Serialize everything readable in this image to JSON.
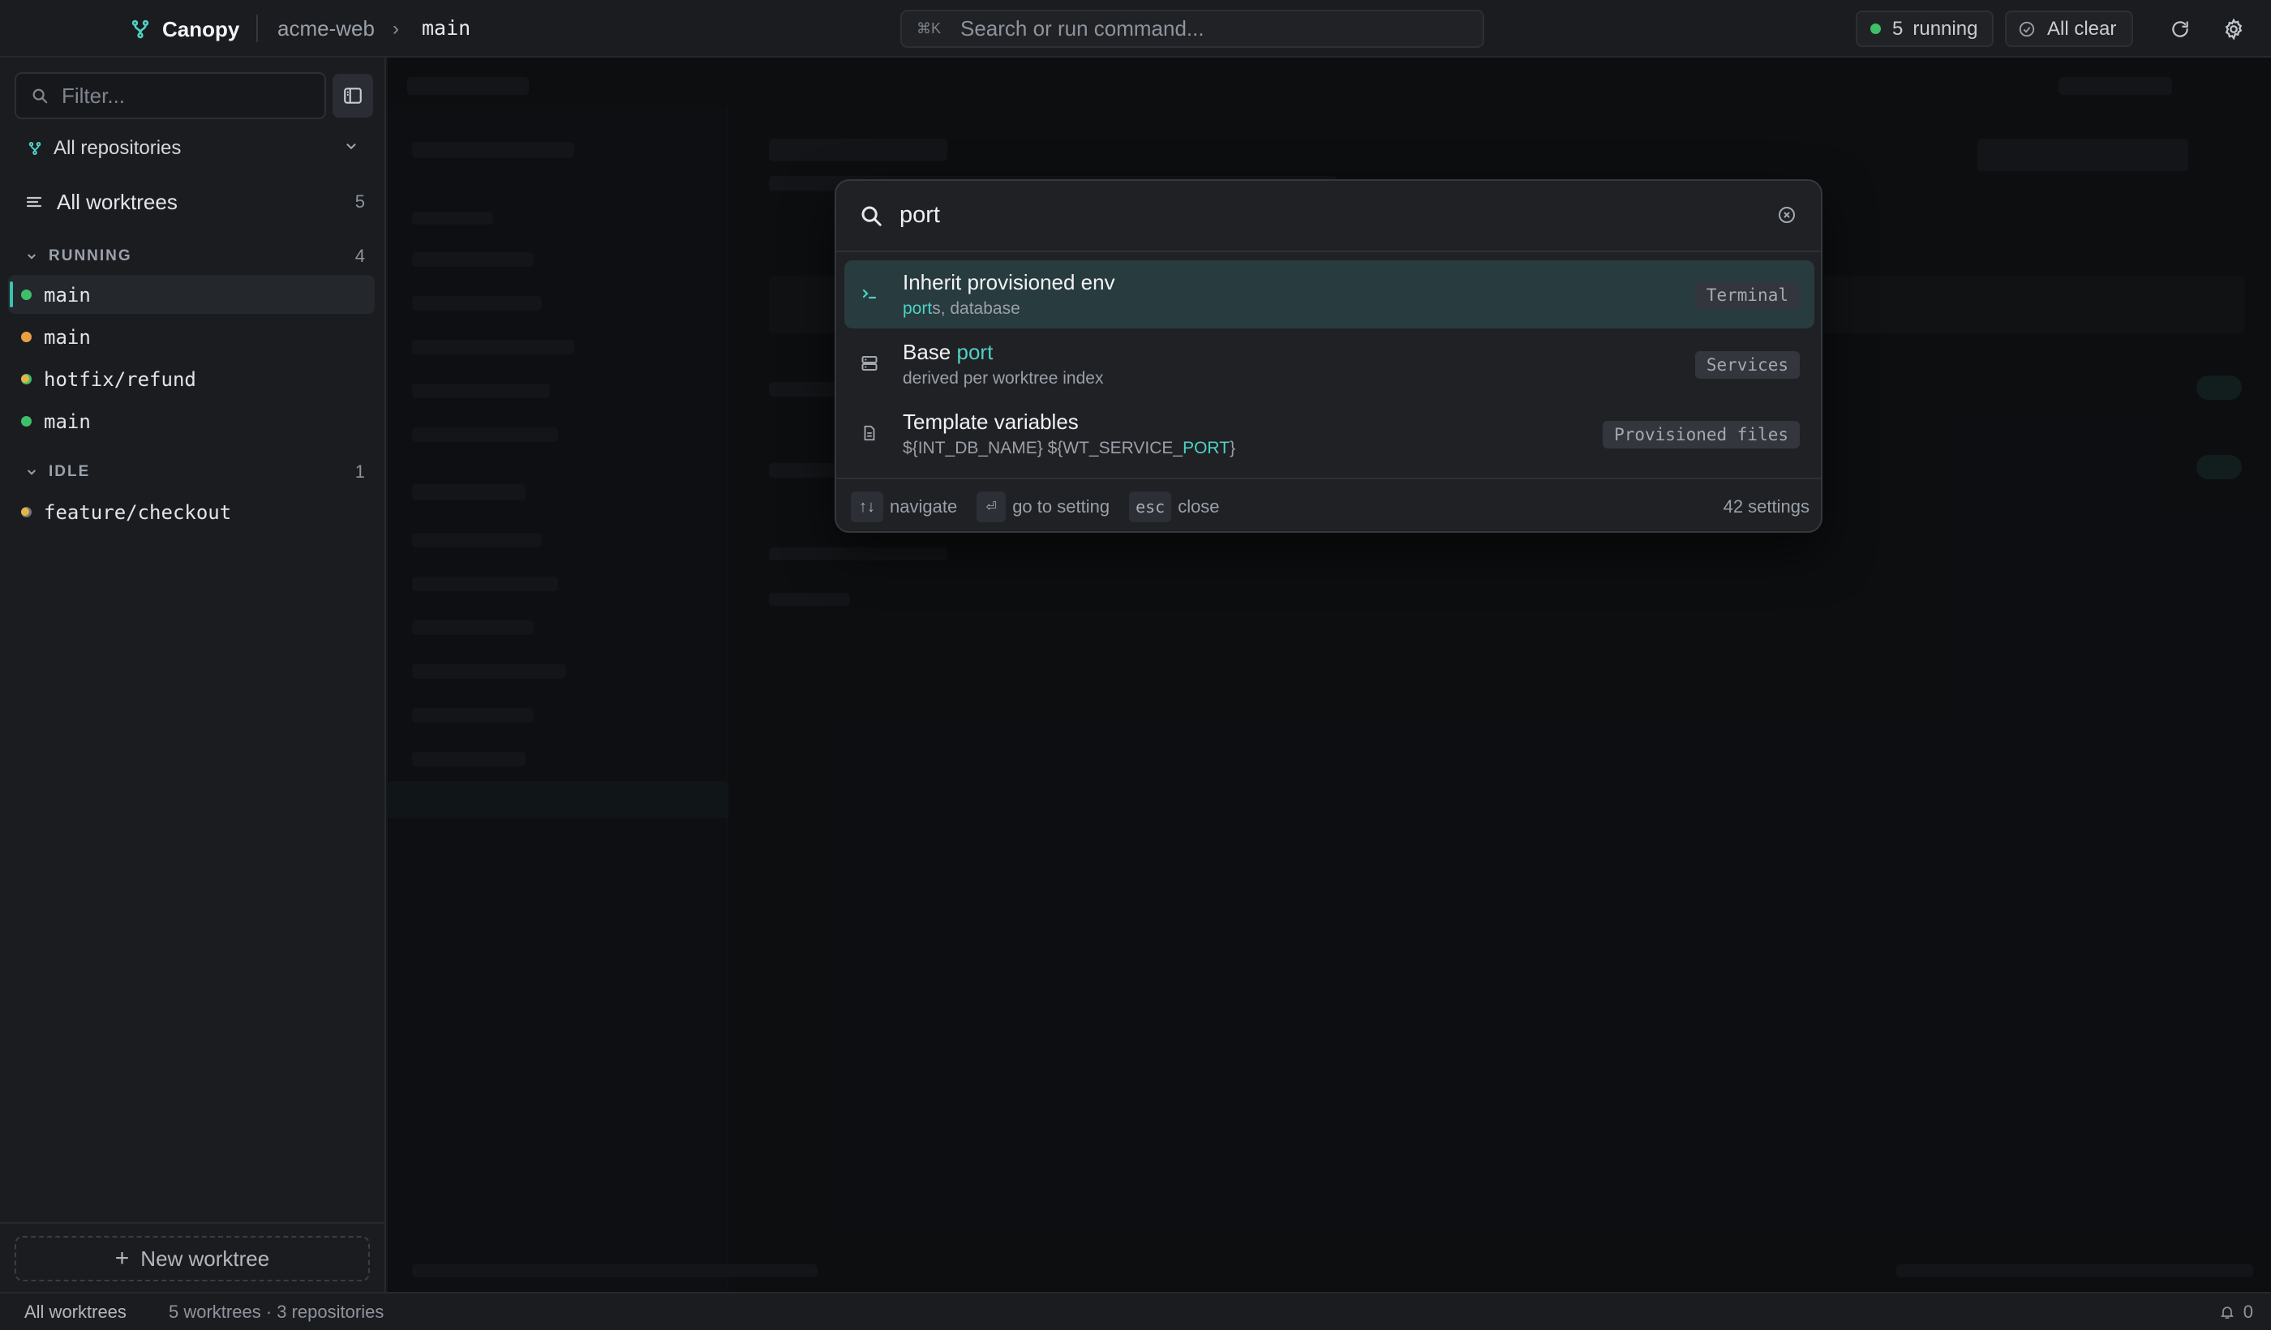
{
  "app": {
    "name": "Canopy",
    "repo": "acme-web",
    "branch": "main"
  },
  "topbar": {
    "command_shortcut": "⌘K",
    "command_placeholder": "Search or run command...",
    "running_count": "5",
    "running_label": "running",
    "status_label": "All clear"
  },
  "sidebar": {
    "filter_placeholder": "Filter...",
    "repo_select": "All repositories",
    "all_worktrees": {
      "label": "All worktrees",
      "count": "5"
    },
    "sections": [
      {
        "title": "RUNNING",
        "count": "4",
        "items": [
          {
            "name": "main",
            "status": "running",
            "active": true,
            "modified": false
          },
          {
            "name": "main",
            "status": "starting",
            "active": false,
            "modified": false
          },
          {
            "name": "hotfix/refund",
            "status": "running",
            "active": false,
            "modified": true
          },
          {
            "name": "main",
            "status": "running",
            "active": false,
            "modified": false
          }
        ]
      },
      {
        "title": "IDLE",
        "count": "1",
        "items": [
          {
            "name": "feature/checkout",
            "status": "idle",
            "active": false,
            "modified": true
          }
        ]
      }
    ],
    "new_worktree": "New worktree"
  },
  "statusbar": {
    "left": "All worktrees",
    "summary": "5 worktrees · 3 repositories",
    "notifications": "0"
  },
  "palette": {
    "query": "port",
    "results": [
      {
        "title": "Inherit provisioned env",
        "subtitle_match": "port",
        "subtitle_rest": "s, database",
        "tag": "Terminal",
        "icon": "terminal-icon",
        "selected": true
      },
      {
        "title_prefix": "Base ",
        "title_match": "port",
        "subtitle": "derived per worktree index",
        "tag": "Services",
        "icon": "server-icon",
        "selected": false
      },
      {
        "title": "Template variables",
        "subtitle_prefix": "${INT_DB_NAME} ${WT_SERVICE_",
        "subtitle_match": "PORT",
        "subtitle_suffix": "}",
        "tag": "Provisioned files",
        "icon": "file-icon",
        "selected": false
      }
    ],
    "footer": {
      "navigate_key": "↑↓",
      "navigate_label": "navigate",
      "enter_key": "⏎",
      "enter_label": "go to setting",
      "esc_key": "esc",
      "esc_label": "close",
      "count": "42 settings"
    }
  },
  "colors": {
    "accent": "#4fd1c5",
    "running": "#3fbf6a",
    "starting": "#e9a045",
    "idle": "#6e737b",
    "modified": "#e5b448"
  }
}
